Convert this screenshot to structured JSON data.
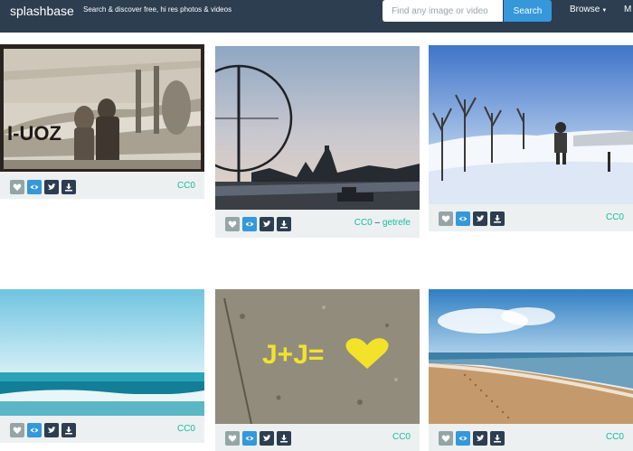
{
  "brand": "splashbase",
  "tagline": "Search & discover free, hi res photos & videos",
  "search": {
    "placeholder": "Find any image or video",
    "button_label": "Search"
  },
  "nav": {
    "browse_label": "Browse",
    "more_label": "M"
  },
  "colors": {
    "navbar": "#2c3e50",
    "accent": "#3498db",
    "license_green": "#18bc9c",
    "card_footer": "#ecf0f1"
  },
  "photos": [
    {
      "license": "CC0",
      "author": ""
    },
    {
      "license": "CC0",
      "separator": "–",
      "author": "getrefe"
    },
    {
      "license": "CC0",
      "author": ""
    },
    {
      "license": "CC0",
      "author": ""
    },
    {
      "license": "CC0",
      "author": ""
    },
    {
      "license": "CC0",
      "author": ""
    }
  ],
  "actions": {
    "like": "heart-icon",
    "view": "eye-icon",
    "tweet": "twitter-icon",
    "download": "download-icon"
  }
}
